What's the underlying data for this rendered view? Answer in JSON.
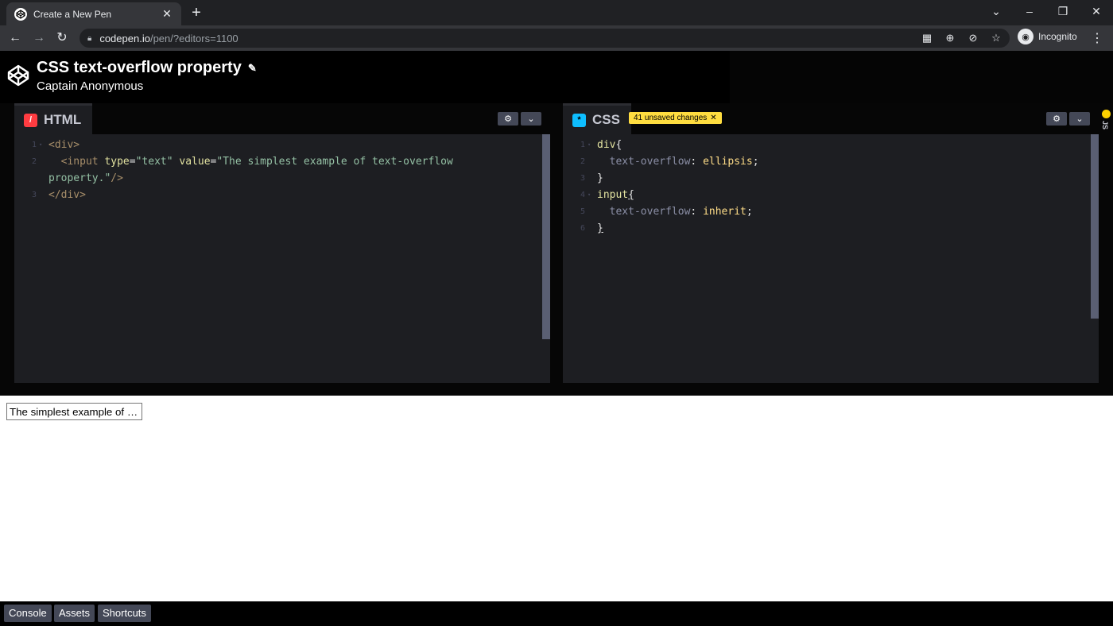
{
  "browser": {
    "tab_title": "Create a New Pen",
    "url_host": "codepen.io",
    "url_path": "/pen/?editors=1100",
    "profile_label": "Incognito"
  },
  "pen": {
    "title": "CSS text-overflow property",
    "author": "Captain Anonymous"
  },
  "editors": {
    "html": {
      "label": "HTML",
      "lines": [
        {
          "n": "1",
          "fold": true
        },
        {
          "n": "2",
          "fold": false
        },
        {
          "n": "",
          "fold": false
        },
        {
          "n": "3",
          "fold": false
        }
      ],
      "text": {
        "l1": "<div>",
        "l2_open": "  <input ",
        "l2_attr1": "type",
        "l2_eq1": "=",
        "l2_val1": "\"text\"",
        "l2_sp": " ",
        "l2_attr2": "value",
        "l2_eq2": "=",
        "l2_val2": "\"The simplest example of text-overflow",
        "l3_val": "property.\"",
        "l3_close": "/>",
        "l4": "</div>"
      }
    },
    "css": {
      "label": "CSS",
      "badge": "41 unsaved changes",
      "text": {
        "l1_sel": "div",
        "l1_brace": "{",
        "l2_prop": "  text-overflow",
        "l2_colon": ": ",
        "l2_val": "ellipsis",
        "l2_semi": ";",
        "l3": "}",
        "l4_sel": "input",
        "l4_brace": "{",
        "l5_prop": "  text-overflow",
        "l5_colon": ": ",
        "l5_val": "inherit",
        "l5_semi": ";",
        "l6": "}"
      },
      "line_numbers": [
        "1",
        "2",
        "3",
        "4",
        "5",
        "6"
      ]
    },
    "js_label": "JS"
  },
  "preview": {
    "input_value": "The simplest example of text-overflow property."
  },
  "footer": {
    "console": "Console",
    "assets": "Assets",
    "shortcuts": "Shortcuts"
  },
  "colors": {
    "html_icon": "#ff3c41",
    "css_icon": "#0ebeff",
    "js_icon": "#fcd000",
    "badge": "#ffdd40"
  }
}
